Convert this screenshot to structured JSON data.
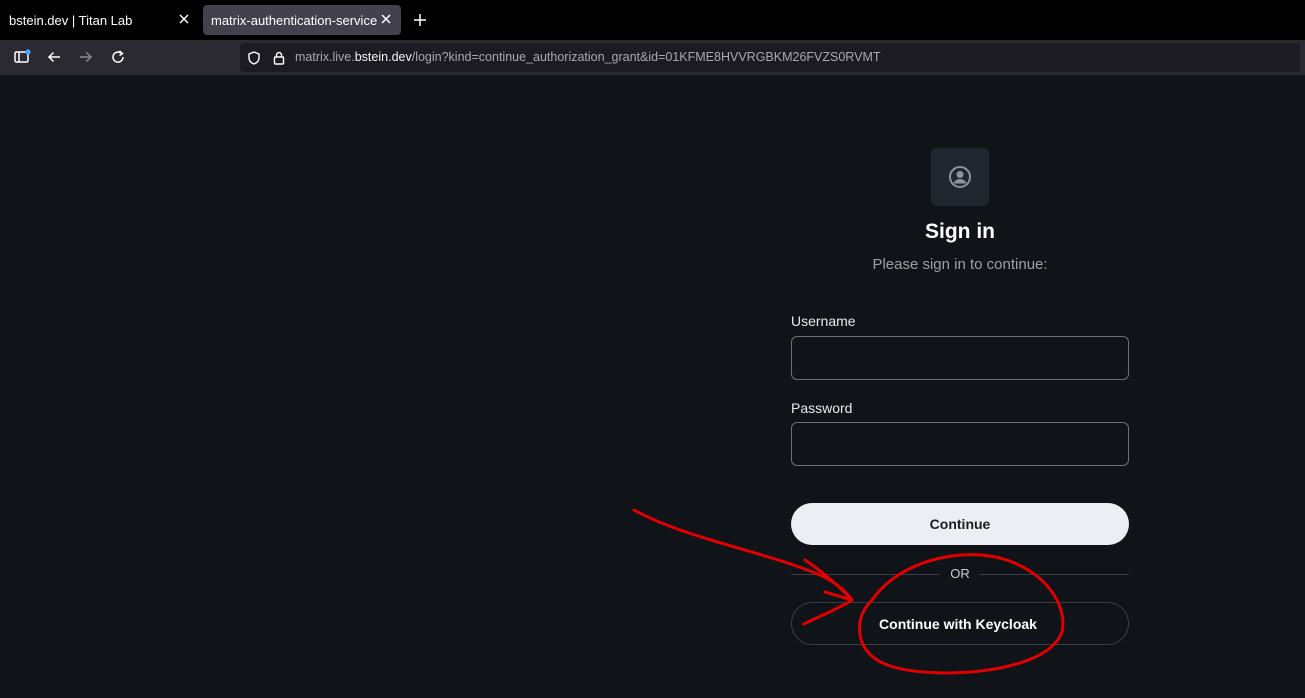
{
  "browser": {
    "tabs": [
      {
        "title": "bstein.dev | Titan Lab",
        "active": false
      },
      {
        "title": "matrix-authentication-service",
        "active": true
      }
    ],
    "url": {
      "prefix": "matrix.live.",
      "host": "bstein.dev",
      "path": "/login?kind=continue_authorization_grant&id=01KFME8HVVRGBKM26FVZS0RVMT"
    },
    "icons": {
      "sidebar": "sidebar-icon",
      "back": "back-arrow-icon",
      "forward": "forward-arrow-icon",
      "reload": "reload-icon",
      "shield": "shield-icon",
      "lock": "lock-icon",
      "close": "close-icon",
      "new_tab": "plus-icon"
    }
  },
  "login": {
    "title": "Sign in",
    "subtitle": "Please sign in to continue:",
    "username_label": "Username",
    "username_value": "",
    "password_label": "Password",
    "password_value": "",
    "continue_label": "Continue",
    "divider_text": "OR",
    "sso_label": "Continue with Keycloak"
  },
  "colors": {
    "page_background": "#101318",
    "primary_button": "#ebeef2",
    "annotation": "#e00000",
    "active_tab": "#42414d"
  }
}
